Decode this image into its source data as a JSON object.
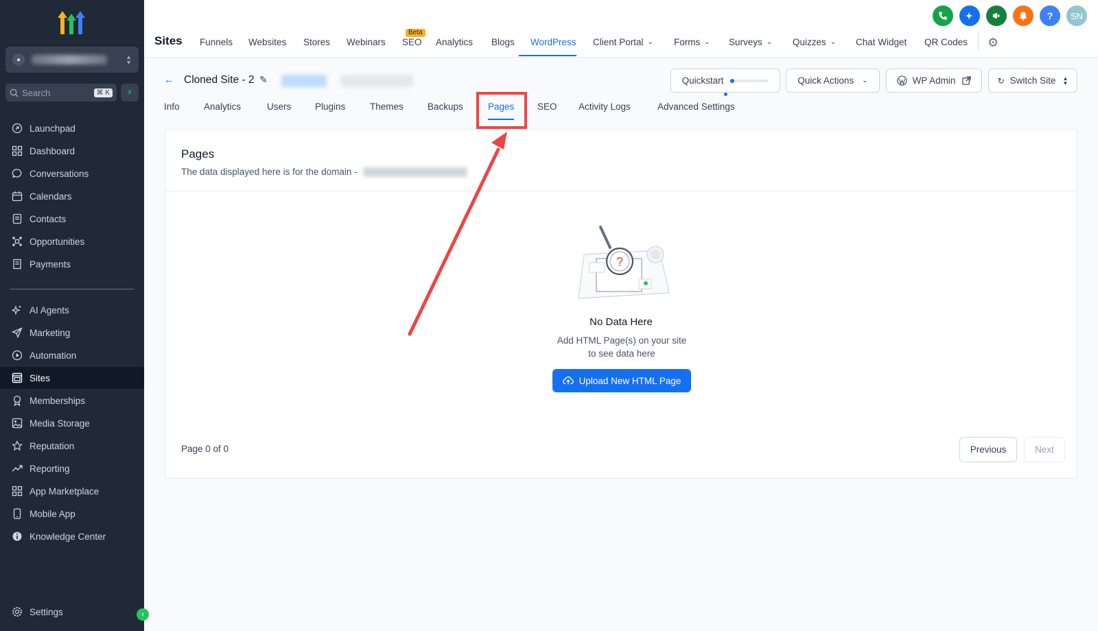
{
  "sidebar": {
    "search_placeholder": "Search",
    "search_shortcut": "⌘ K",
    "items": [
      {
        "label": "Launchpad",
        "icon": "rocket-icon"
      },
      {
        "label": "Dashboard",
        "icon": "grid-icon"
      },
      {
        "label": "Conversations",
        "icon": "chat-bubble-icon"
      },
      {
        "label": "Calendars",
        "icon": "calendar-icon"
      },
      {
        "label": "Contacts",
        "icon": "contacts-icon"
      },
      {
        "label": "Opportunities",
        "icon": "opportunities-icon"
      },
      {
        "label": "Payments",
        "icon": "payments-icon"
      },
      {
        "label": "AI Agents",
        "icon": "sparkle-icon"
      },
      {
        "label": "Marketing",
        "icon": "send-icon"
      },
      {
        "label": "Automation",
        "icon": "automation-icon"
      },
      {
        "label": "Sites",
        "icon": "sites-icon"
      },
      {
        "label": "Memberships",
        "icon": "membership-icon"
      },
      {
        "label": "Media Storage",
        "icon": "image-icon"
      },
      {
        "label": "Reputation",
        "icon": "star-icon"
      },
      {
        "label": "Reporting",
        "icon": "trend-icon"
      },
      {
        "label": "App Marketplace",
        "icon": "apps-icon"
      },
      {
        "label": "Mobile App",
        "icon": "phone-icon"
      },
      {
        "label": "Knowledge Center",
        "icon": "info-icon"
      },
      {
        "label": "Settings",
        "icon": "gear-icon"
      }
    ]
  },
  "topnav": {
    "title": "Sites",
    "beta_label": "Beta",
    "tabs": [
      {
        "label": "Funnels"
      },
      {
        "label": "Websites"
      },
      {
        "label": "Stores"
      },
      {
        "label": "Webinars"
      },
      {
        "label": "SEO"
      },
      {
        "label": "Analytics"
      },
      {
        "label": "Blogs"
      },
      {
        "label": "WordPress"
      },
      {
        "label": "Client Portal"
      },
      {
        "label": "Forms"
      },
      {
        "label": "Surveys"
      },
      {
        "label": "Quizzes"
      },
      {
        "label": "Chat Widget"
      },
      {
        "label": "QR Codes"
      }
    ],
    "active_tab": "WordPress",
    "user_initials": "SN",
    "help_label": "?"
  },
  "site_header": {
    "title": "Cloned Site - 2",
    "quickstart_label": "Quickstart",
    "quickstart_progress": 0.1,
    "quick_actions_label": "Quick Actions",
    "wp_admin_label": "WP Admin",
    "switch_site_label": "Switch Site"
  },
  "subtabs": [
    {
      "label": "Info"
    },
    {
      "label": "Analytics"
    },
    {
      "label": "Users"
    },
    {
      "label": "Plugins"
    },
    {
      "label": "Themes"
    },
    {
      "label": "Backups"
    },
    {
      "label": "Pages"
    },
    {
      "label": "SEO"
    },
    {
      "label": "Activity Logs"
    },
    {
      "label": "Advanced Settings"
    }
  ],
  "active_subtab": "Pages",
  "pages_card": {
    "title": "Pages",
    "subtitle": "The data displayed here is for the domain -",
    "empty_title": "No Data Here",
    "empty_desc": "Add HTML Page(s) on your site to see data here",
    "upload_label": "Upload New HTML Page",
    "page_count": "Page 0 of 0",
    "previous_label": "Previous",
    "next_label": "Next"
  },
  "colors": {
    "sidebar_bg": "#1f2937",
    "accent": "#1570ef",
    "annotation": "#ef4444"
  }
}
